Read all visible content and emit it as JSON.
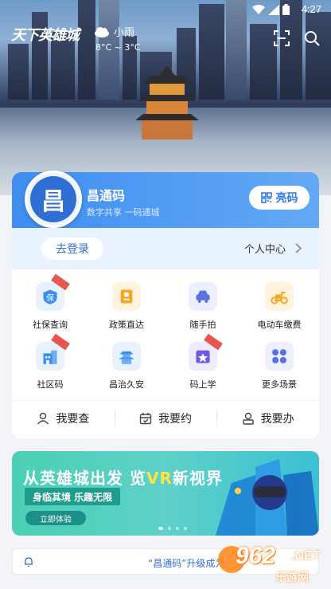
{
  "status": {
    "time": "4:27"
  },
  "header": {
    "brand": "天下英雄城",
    "weather": {
      "condition": "小雨",
      "temp": "8°C ~ 3°C"
    }
  },
  "code_card": {
    "seal_char": "昌",
    "title": "昌通码",
    "subtitle": "数字共享 一码通城",
    "show_code_label": "亮码"
  },
  "login": {
    "button_label": "去登录",
    "personal_center": "个人中心"
  },
  "services": [
    {
      "label": "社保查询",
      "icon": "shield-icon",
      "color": "#3b8ff0",
      "bg": "#e8f2ff",
      "ribbon": true
    },
    {
      "label": "政策直达",
      "icon": "policy-icon",
      "color": "#f5a623",
      "bg": "#fff3de",
      "ribbon": false
    },
    {
      "label": "随手拍",
      "icon": "car-icon",
      "color": "#5b72e0",
      "bg": "#ecefff",
      "ribbon": false
    },
    {
      "label": "电动车缴费",
      "icon": "scooter-icon",
      "color": "#f5a623",
      "bg": "#fff3de",
      "ribbon": false
    },
    {
      "label": "社区码",
      "icon": "community-icon",
      "color": "#3b8ff0",
      "bg": "#e8f2ff",
      "ribbon": true
    },
    {
      "label": "昌治久安",
      "icon": "pagoda-icon",
      "color": "#3b8ff0",
      "bg": "#e8f2ff",
      "ribbon": false
    },
    {
      "label": "码上学",
      "icon": "learn-icon",
      "color": "#6b5be0",
      "bg": "#eeeaff",
      "ribbon": true
    },
    {
      "label": "更多场景",
      "icon": "grid-icon",
      "color": "#5b72e0",
      "bg": "#ecefff",
      "ribbon": false
    }
  ],
  "tabs": [
    {
      "label": "我要查",
      "icon": "person-icon"
    },
    {
      "label": "我要约",
      "icon": "calendar-icon"
    },
    {
      "label": "我要办",
      "icon": "user-badge-icon"
    }
  ],
  "banner": {
    "headline_pre": "从英雄城出发 览",
    "headline_vr": "VR",
    "headline_post": "新视界",
    "tagline": "身临其境 乐趣无限",
    "cta": "立即体验"
  },
  "notice": {
    "text": "“昌通码”升级成为"
  },
  "watermark": {
    "number": "962",
    "net": ".NET",
    "site": "乐游网"
  }
}
